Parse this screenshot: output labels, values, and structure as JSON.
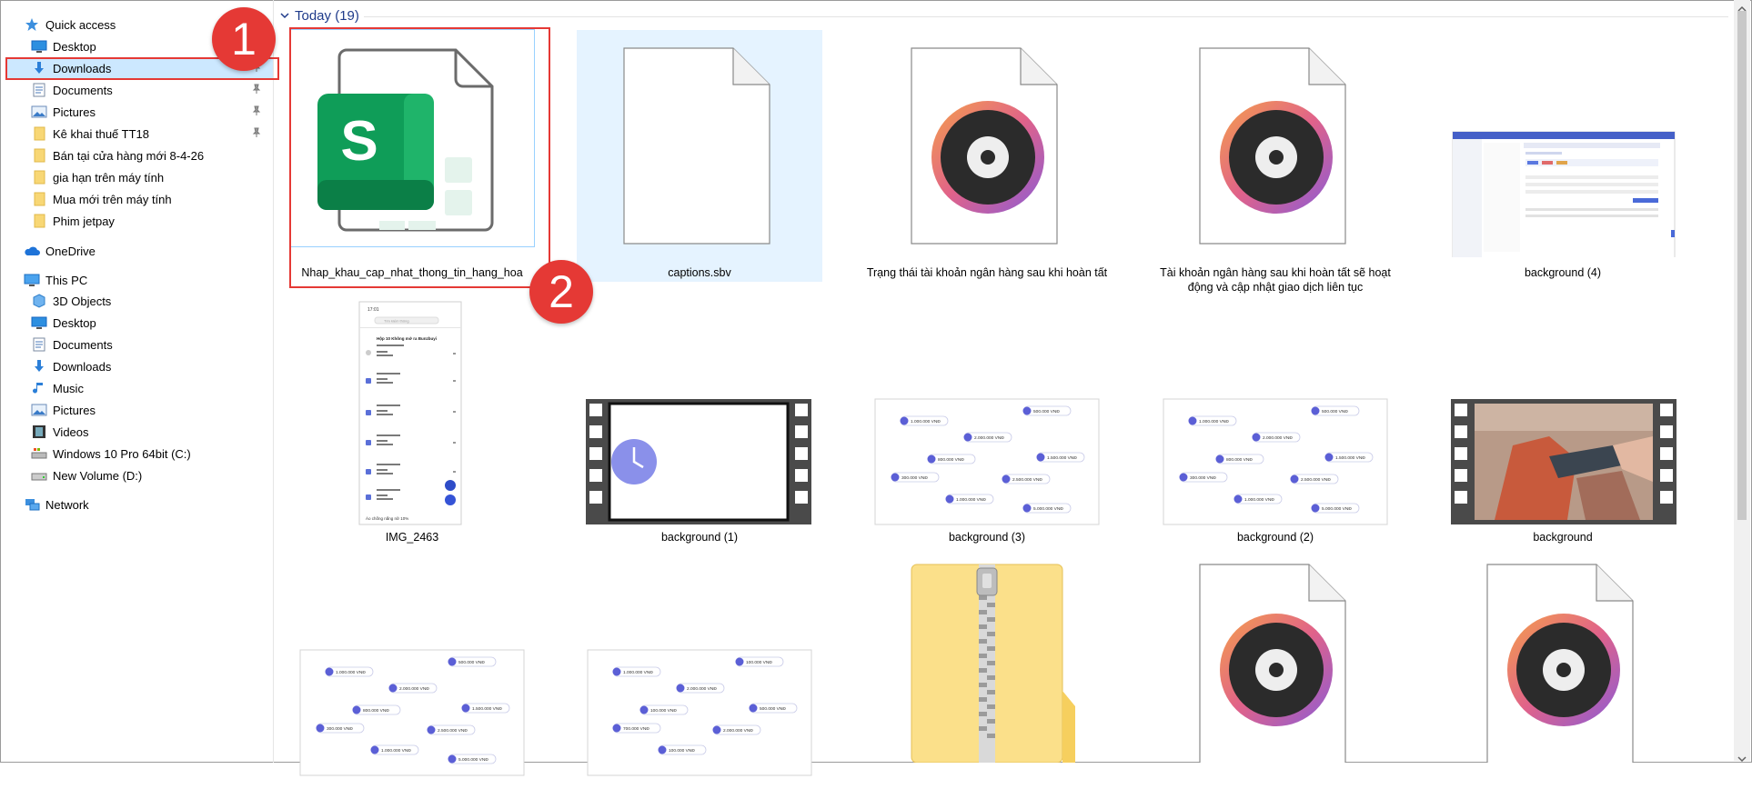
{
  "sidebar": {
    "quick_access": "Quick access",
    "items": [
      {
        "label": "Desktop",
        "icon": "desktop-icon",
        "pinned": true
      },
      {
        "label": "Downloads",
        "icon": "download-icon",
        "pinned": true
      },
      {
        "label": "Documents",
        "icon": "document-icon",
        "pinned": true
      },
      {
        "label": "Pictures",
        "icon": "pictures-icon",
        "pinned": true
      },
      {
        "label": "Kê khai thuế TT18",
        "icon": "folder-icon",
        "pinned": true
      },
      {
        "label": "Bán tại cửa hàng mới 8-4-26",
        "icon": "folder-icon"
      },
      {
        "label": "gia hạn trên máy tính",
        "icon": "folder-icon"
      },
      {
        "label": "Mua mới trên máy tính",
        "icon": "folder-icon"
      },
      {
        "label": "Phim jetpay",
        "icon": "folder-icon"
      }
    ],
    "onedrive": "OneDrive",
    "this_pc": "This PC",
    "pc_items": [
      {
        "label": "3D Objects",
        "icon": "3d-objects-icon"
      },
      {
        "label": "Desktop",
        "icon": "desktop-icon"
      },
      {
        "label": "Documents",
        "icon": "document-icon"
      },
      {
        "label": "Downloads",
        "icon": "download-icon"
      },
      {
        "label": "Music",
        "icon": "music-icon"
      },
      {
        "label": "Pictures",
        "icon": "pictures-icon"
      },
      {
        "label": "Videos",
        "icon": "videos-icon"
      },
      {
        "label": "Windows 10 Pro 64bit (C:)",
        "icon": "drive-c-icon"
      },
      {
        "label": "New Volume (D:)",
        "icon": "drive-d-icon"
      }
    ],
    "network": "Network"
  },
  "group": {
    "label": "Today (19)"
  },
  "files": [
    {
      "name": "Nhap_khau_cap_nhat_thong_tin_hang_hoa",
      "icon": "spreadsheet-icon"
    },
    {
      "name": "captions.sbv",
      "icon": "blank-file-icon"
    },
    {
      "name": "Trạng thái tài khoản ngân hàng sau khi hoàn tất",
      "icon": "media-file-icon"
    },
    {
      "name": "Tài khoản ngân hàng sau khi hoàn tất sẽ hoạt động và cập nhật giao dịch liên tục",
      "icon": "media-file-icon"
    },
    {
      "name": "background (4)",
      "icon": "screenshot-thumbnail"
    },
    {
      "name": "IMG_2463",
      "icon": "phone-screenshot-thumbnail"
    },
    {
      "name": "background (1)",
      "icon": "video-clock-thumbnail"
    },
    {
      "name": "background (3)",
      "icon": "price-tags-thumbnail"
    },
    {
      "name": "background (2)",
      "icon": "price-tags-thumbnail"
    },
    {
      "name": "background",
      "icon": "video-payment-thumbnail"
    },
    {
      "name": "",
      "icon": "price-tags-thumbnail"
    },
    {
      "name": "",
      "icon": "price-tags-thumbnail"
    },
    {
      "name": "",
      "icon": "zip-folder-icon"
    },
    {
      "name": "",
      "icon": "media-file-icon"
    },
    {
      "name": "",
      "icon": "media-file-icon"
    }
  ],
  "price_tags_a": [
    "1.000.000 VNĐ",
    "500.000 VNĐ",
    "2.000.000 VNĐ",
    "800.000 VNĐ",
    "1.500.000 VNĐ",
    "300.000 VNĐ",
    "2.500.000 VNĐ",
    "1.000.000 VNĐ",
    "5.000.000 VNĐ"
  ],
  "price_tags_b": [
    "1.000.000 VNĐ",
    "100.000 VNĐ",
    "2.000.000 VNĐ",
    "500.000 VNĐ",
    "100.000 VNĐ",
    "700.000 VNĐ",
    "2.000.000 VNĐ",
    "100.000 VNĐ"
  ],
  "phone": {
    "time": "17:01",
    "search": "Tìm kiếm thông",
    "title": "Hộp 10 Không mở ra Bunzbuyi",
    "footer": "Áo chống nắng nữ 10%"
  },
  "annotations": [
    "1",
    "2"
  ],
  "colors": {
    "accent": "#0078d7",
    "selection": "#cce8ff",
    "annotation": "#e53935",
    "group_header": "#1e3a8a"
  }
}
